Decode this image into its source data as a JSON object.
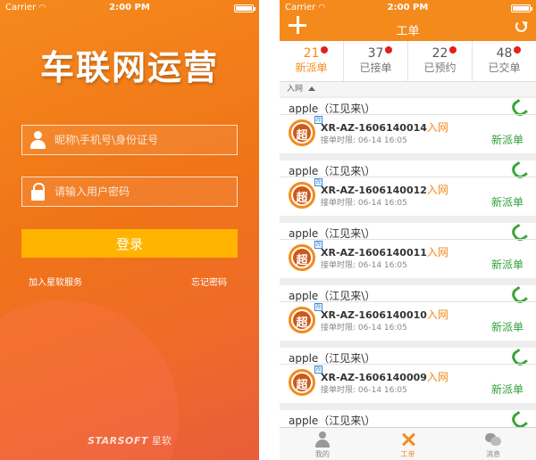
{
  "login_screen": {
    "status": {
      "carrier": "Carrier",
      "time": "2:00 PM"
    },
    "title": "车联网运营",
    "username_placeholder": "昵称\\手机号\\身份证号",
    "password_placeholder": "请输入用户密码",
    "login_label": "登录",
    "join_link": "加入星软服务",
    "forgot_link": "忘记密码",
    "brand_en": "STARSOFT",
    "brand_cn": "星软"
  },
  "orders_screen": {
    "status": {
      "carrier": "Carrier",
      "time": "2:00 PM"
    },
    "title": "工单",
    "tabs": [
      {
        "count": "21",
        "label": "新派单"
      },
      {
        "count": "37",
        "label": "已接单"
      },
      {
        "count": "22",
        "label": "已预约"
      },
      {
        "count": "48",
        "label": "已交单"
      }
    ],
    "section_label": "入网",
    "orders": [
      {
        "name": "apple（江见来\\）",
        "avatar": "超",
        "badge": "改",
        "order_no": "XR-AZ-1606140014",
        "type": "入网",
        "time": "接单时限: 06-14 16:05",
        "status": "新派单"
      },
      {
        "name": "apple（江见来\\）",
        "avatar": "超",
        "badge": "改",
        "order_no": "XR-AZ-1606140012",
        "type": "入网",
        "time": "接单时限: 06-14 16:05",
        "status": "新派单"
      },
      {
        "name": "apple（江见来\\）",
        "avatar": "超",
        "badge": "改",
        "order_no": "XR-AZ-1606140011",
        "type": "入网",
        "time": "接单时限: 06-14 16:05",
        "status": "新派单"
      },
      {
        "name": "apple（江见来\\）",
        "avatar": "超",
        "badge": "改",
        "order_no": "XR-AZ-1606140010",
        "type": "入网",
        "time": "接单时限: 06-14 16:05",
        "status": "新派单"
      },
      {
        "name": "apple（江见来\\）",
        "avatar": "超",
        "badge": "改",
        "order_no": "XR-AZ-1606140009",
        "type": "入网",
        "time": "接单时限: 06-14 16:05",
        "status": "新派单"
      },
      {
        "name": "apple（江见来\\）"
      }
    ],
    "bottom_tabs": [
      {
        "label": "我的"
      },
      {
        "label": "工单"
      },
      {
        "label": "消息"
      }
    ]
  }
}
